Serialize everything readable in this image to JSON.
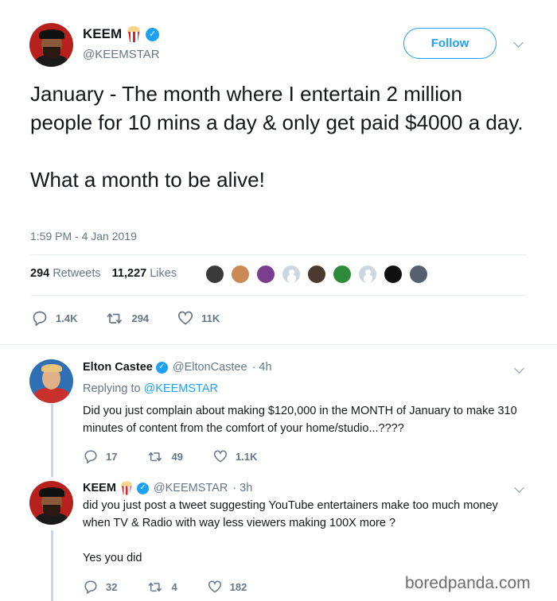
{
  "tweet": {
    "author_name": "KEEM",
    "author_handle": "@KEEMSTAR",
    "follow_label": "Follow",
    "text_lines": [
      "January - The month where I entertain 2 million people for 10 mins a day & only get paid $4000 a day.",
      "What a month to be alive!"
    ],
    "timestamp": "1:59 PM - 4 Jan 2019",
    "retweets_count": "294",
    "retweets_label": "Retweets",
    "likes_count": "11,227",
    "likes_label": "Likes",
    "likers_shown": 10,
    "actions": {
      "replies": "1.4K",
      "retweets": "294",
      "likes": "11K"
    }
  },
  "replies": [
    {
      "name": "Elton Castee",
      "handle": "@EltonCastee",
      "time": "· 4h",
      "replying_prefix": "Replying to",
      "replying_to": "@KEEMSTAR",
      "text": "Did you just complain about making $120,000 in the MONTH of January to make 310 minutes of content from the comfort of your home/studio...????",
      "actions": {
        "replies": "17",
        "retweets": "49",
        "likes": "1.1K"
      }
    },
    {
      "name": "KEEM",
      "handle": "@KEEMSTAR",
      "time": "· 3h",
      "text": "did you just post a tweet suggesting YouTube entertainers make too much money when TV & Radio with way less viewers making 100X more ?",
      "text2": "Yes you did",
      "actions": {
        "replies": "32",
        "retweets": "4",
        "likes": "182"
      }
    }
  ],
  "watermark": "boredpanda.com",
  "colors": {
    "accent": "#1da1f2",
    "secondary_text": "#657786",
    "divider": "#e6ecf0"
  },
  "icons": [
    "popcorn-emoji",
    "verified-badge-icon",
    "chevron-down-icon",
    "reply-icon",
    "retweet-icon",
    "heart-icon"
  ]
}
